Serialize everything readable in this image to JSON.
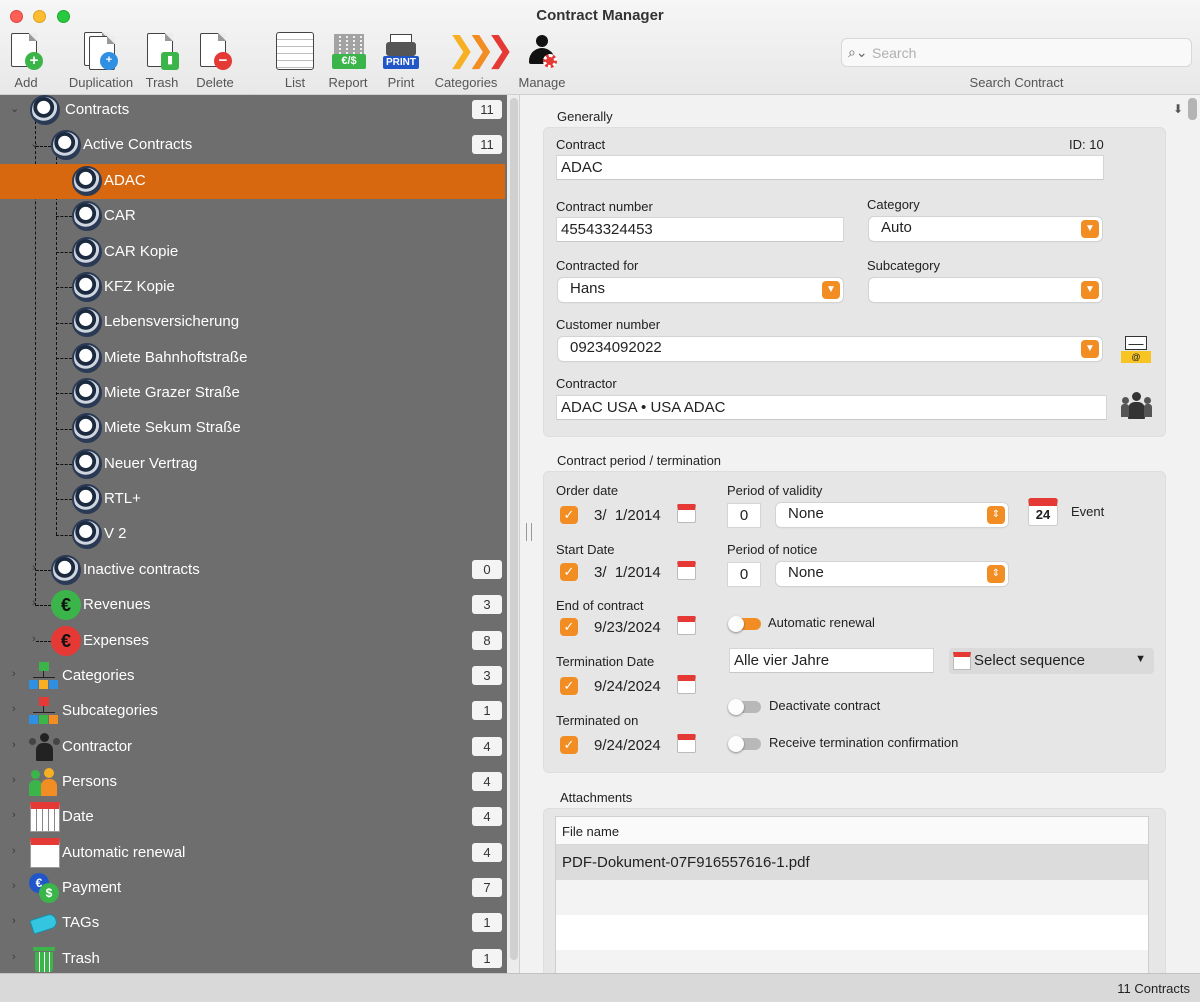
{
  "window": {
    "title": "Contract Manager"
  },
  "toolbar": {
    "add": "Add",
    "duplication": "Duplication",
    "trash": "Trash",
    "delete": "Delete",
    "list": "List",
    "report": "Report",
    "report_icon_text": "€/$",
    "print": "Print",
    "print_icon_text": "PRINT",
    "categories": "Categories",
    "manage": "Manage"
  },
  "search": {
    "placeholder": "Search",
    "label": "Search Contract"
  },
  "sidebar": {
    "contracts": {
      "label": "Contracts",
      "count": "11"
    },
    "active_contracts": {
      "label": "Active Contracts",
      "count": "11"
    },
    "contract_items": [
      "ADAC",
      "CAR",
      "CAR Kopie",
      "KFZ Kopie",
      "Lebensversicherung",
      "Miete Bahnhoftstraße",
      "Miete Grazer Straße",
      "Miete Sekum Straße",
      "Neuer Vertrag",
      "RTL+",
      "V 2"
    ],
    "inactive_contracts": {
      "label": "Inactive contracts",
      "count": "0"
    },
    "revenues": {
      "label": "Revenues",
      "count": "3"
    },
    "expenses": {
      "label": "Expenses",
      "count": "8"
    },
    "groups": [
      {
        "label": "Categories",
        "count": "3",
        "icon": "hierarchy-icon"
      },
      {
        "label": "Subcategories",
        "count": "1",
        "icon": "hierarchy-icon"
      },
      {
        "label": "Contractor",
        "count": "4",
        "icon": "people-icon"
      },
      {
        "label": "Persons",
        "count": "4",
        "icon": "persons-icon"
      },
      {
        "label": "Date",
        "count": "4",
        "icon": "calendar-icon"
      },
      {
        "label": "Automatic renewal",
        "count": "4",
        "icon": "calendar-icon"
      },
      {
        "label": "Payment",
        "count": "7",
        "icon": "payment-icon"
      },
      {
        "label": "TAGs",
        "count": "1",
        "icon": "tag-icon"
      },
      {
        "label": "Trash",
        "count": "1",
        "icon": "trash-icon"
      }
    ]
  },
  "form": {
    "generally": {
      "title": "Generally",
      "contract_label": "Contract",
      "id_text": "ID: 10",
      "contract_value": "ADAC",
      "contract_number_label": "Contract number",
      "contract_number_value": "45543324453",
      "category_label": "Category",
      "category_value": "Auto",
      "contracted_for_label": "Contracted for",
      "contracted_for_value": "Hans",
      "subcategory_label": "Subcategory",
      "subcategory_value": "",
      "customer_number_label": "Customer number",
      "customer_number_value": "09234092022",
      "contractor_label": "Contractor",
      "contractor_value": "ADAC USA • USA ADAC"
    },
    "period": {
      "title": "Contract period / termination",
      "order_date_label": "Order date",
      "order_date_value": "3/  1/2014",
      "period_validity_label": "Period of validity",
      "period_validity_number": "0",
      "period_validity_unit": "None",
      "event_calendar_day": "24",
      "event_label": "Event",
      "start_date_label": "Start Date",
      "start_date_value": "3/  1/2014",
      "period_notice_label": "Period of notice",
      "period_notice_number": "0",
      "period_notice_unit": "None",
      "end_contract_label": "End of contract",
      "end_contract_value": "9/23/2024",
      "automatic_renewal_label": "Automatic renewal",
      "automatic_renewal_on": true,
      "termination_date_label": "Termination Date",
      "termination_date_value": "9/24/2024",
      "sequence_text": "Alle vier Jahre",
      "select_sequence": "Select sequence",
      "deactivate_label": "Deactivate contract",
      "terminated_on_label": "Terminated on",
      "terminated_on_value": "9/24/2024",
      "receive_confirmation_label": "Receive termination confirmation"
    },
    "attachments": {
      "title": "Attachments",
      "column_header": "File name",
      "files": [
        "PDF-Dokument-07F916557616-1.pdf"
      ]
    }
  },
  "status": {
    "count_text": "11 Contracts"
  },
  "colors": {
    "accent": "#f28d24",
    "selection": "#d8680f",
    "sidebar_bg": "#6e6e6e"
  }
}
